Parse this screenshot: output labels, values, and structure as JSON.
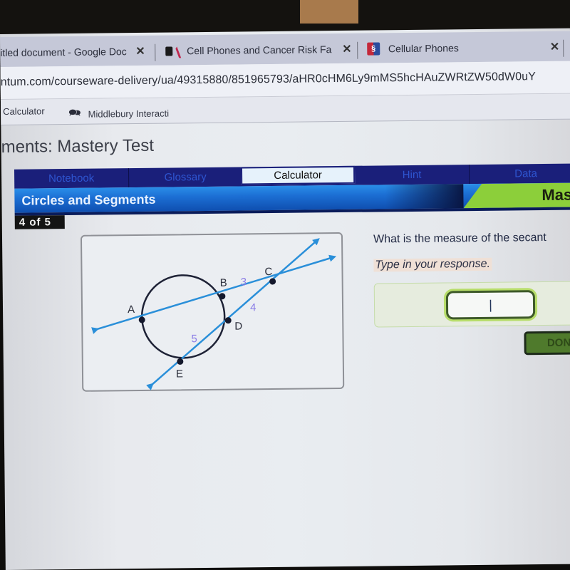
{
  "browser": {
    "tabs": [
      {
        "title": "itled document - Google Doc",
        "icon": "google-docs-icon",
        "close": "✕"
      },
      {
        "title": "Cell Phones and Cancer Risk Fa",
        "icon": "pearson-icon",
        "close": "✕"
      },
      {
        "title": "Cellular Phones",
        "icon": "cellular-phones-icon",
        "close": "✕"
      }
    ],
    "url": "ntum.com/courseware-delivery/ua/49315880/851965793/aHR0cHM6Ly9mMS5hcHAuZWRtZW50dW0uY",
    "bookmarks": [
      {
        "label": "Calculator"
      },
      {
        "label": "Middlebury Interacti",
        "icon": "chat-bubbles-icon"
      }
    ]
  },
  "page": {
    "title": "ments: Mastery Test",
    "nav_tabs": [
      {
        "label": "Notebook",
        "active": false
      },
      {
        "label": "Glossary",
        "active": false
      },
      {
        "label": "Calculator",
        "active": true
      },
      {
        "label": "Hint",
        "active": false
      },
      {
        "label": "Data",
        "active": false
      }
    ],
    "banner": {
      "title": "Circles and Segments",
      "mode": "Mas"
    },
    "counter": "4 of 5"
  },
  "figure": {
    "points": {
      "A": "A",
      "B": "B",
      "C": "C",
      "D": "D",
      "E": "E"
    },
    "segment_labels": {
      "BC": "3",
      "CD": "4",
      "DE": "5"
    }
  },
  "question": {
    "text": "What is the measure of the secant",
    "instruction": "Type in your response.",
    "answer_value": "",
    "cursor": "|",
    "done_label": "DON"
  },
  "colors": {
    "nav_bar": "#1a1f7a",
    "banner_blue": "#1c6fd4",
    "banner_green": "#8ccf3a",
    "secant_line": "#2a8fd9",
    "segment_label": "#8a7ce6",
    "done_button": "#4f7a2c"
  }
}
